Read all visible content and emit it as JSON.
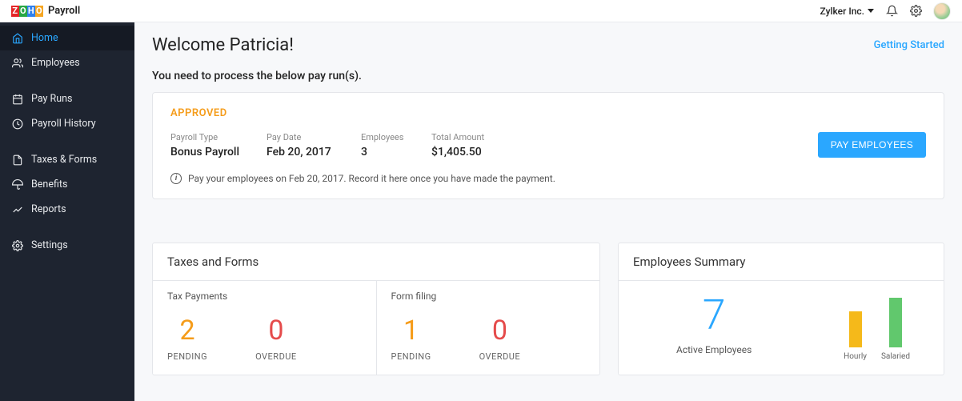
{
  "top": {
    "brandText": "Payroll",
    "orgName": "Zylker Inc."
  },
  "sidebar": {
    "items": [
      {
        "label": "Home"
      },
      {
        "label": "Employees"
      },
      {
        "label": "Pay Runs"
      },
      {
        "label": "Payroll History"
      },
      {
        "label": "Taxes & Forms"
      },
      {
        "label": "Benefits"
      },
      {
        "label": "Reports"
      },
      {
        "label": "Settings"
      }
    ]
  },
  "header": {
    "welcome": "Welcome Patricia!",
    "gettingStarted": "Getting Started"
  },
  "payrun": {
    "needText": "You need to process the below pay run(s).",
    "status": "APPROVED",
    "fields": [
      {
        "label": "Payroll Type",
        "value": "Bonus Payroll"
      },
      {
        "label": "Pay Date",
        "value": "Feb 20, 2017"
      },
      {
        "label": "Employees",
        "value": "3"
      },
      {
        "label": "Total Amount",
        "value": "$1,405.50"
      }
    ],
    "button": "PAY EMPLOYEES",
    "note": "Pay your employees on Feb 20, 2017. Record it here once you have made the payment."
  },
  "taxes": {
    "title": "Taxes and Forms",
    "left": {
      "sub": "Tax Payments",
      "pendingCount": "2",
      "pendingLabel": "PENDING",
      "overdueCount": "0",
      "overdueLabel": "OVERDUE"
    },
    "right": {
      "sub": "Form filing",
      "pendingCount": "1",
      "pendingLabel": "PENDING",
      "overdueCount": "0",
      "overdueLabel": "OVERDUE"
    }
  },
  "employees": {
    "title": "Employees Summary",
    "count": "7",
    "countLabel": "Active Employees",
    "chart": {
      "hourlyLabel": "Hourly",
      "salariedLabel": "Salaried"
    }
  },
  "chart_data": {
    "type": "bar",
    "categories": [
      "Hourly",
      "Salaried"
    ],
    "values": [
      3,
      4
    ],
    "title": "Employees Summary",
    "xlabel": "",
    "ylabel": "",
    "ylim": [
      0,
      7
    ]
  }
}
